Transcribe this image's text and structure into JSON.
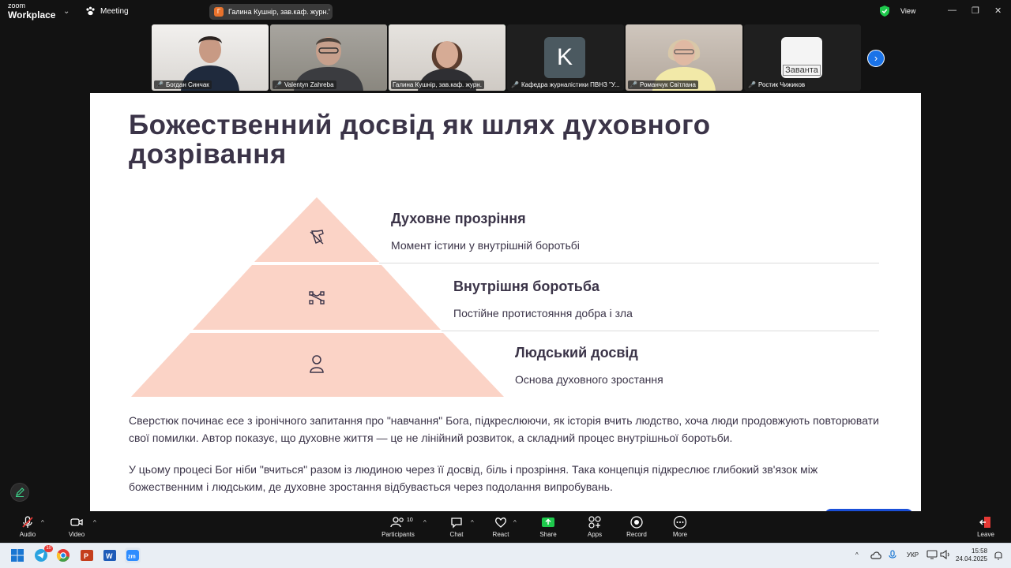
{
  "app": {
    "logo_line1": "zoom",
    "logo_line2": "Workplace",
    "meeting_label": "Meeting",
    "view_label": "View"
  },
  "share": {
    "presenter": "Галина Кушнір, зав.каф. журн.'",
    "presenter_initial": "Г"
  },
  "participants": [
    {
      "name": "Богдан Синчак",
      "type": "video"
    },
    {
      "name": "Valentyn Zahreba",
      "type": "video"
    },
    {
      "name": "Галина Кушнір, зав.каф. журн.",
      "type": "video"
    },
    {
      "name": "Кафедра журналістики ПВНЗ \"У...",
      "type": "avatar",
      "avatar_letter": "K"
    },
    {
      "name": "Романчук Світлана",
      "type": "video"
    },
    {
      "name": "Ростик Чижиков",
      "type": "image",
      "avatar_text": "Заванта"
    }
  ],
  "slide": {
    "title": "Божественний досвід як шлях духовного дозрівання",
    "tiers": [
      {
        "heading": "Духовне прозріння",
        "desc": "Момент істини у внутрішній боротьбі",
        "icon": "hand-pointer-icon"
      },
      {
        "heading": "Внутрішня боротьба",
        "desc": "Постійне протистояння добра і зла",
        "icon": "vector-nodes-icon"
      },
      {
        "heading": "Людський досвід",
        "desc": "Основа духовного зростання",
        "icon": "person-icon"
      }
    ],
    "paragraph1": "Сверстюк починає есе з іронічного запитання про \"навчання\" Бога, підкреслюючи, як історія вчить людство, хоча люди продовжують повторювати свої помилки. Автор показує, що духовне життя — це не лінійний розвиток, а складний процес внутрішньої боротьби.",
    "paragraph2": "У цьому процесі Бог ніби \"вчиться\" разом із людиною через її досвід, біль і прозріння. Така концепція підкреслює глибокий зв'язок між божественним і людським, де духовне зростання відбувається через подолання випробувань.",
    "pyramid_color": "#fbd3c6",
    "text_color": "#3b3448"
  },
  "toolbar": {
    "audio": "Audio",
    "video": "Video",
    "participants": "Participants",
    "participants_count": "10",
    "chat": "Chat",
    "react": "React",
    "share": "Share",
    "apps": "Apps",
    "record": "Record",
    "more": "More",
    "leave": "Leave",
    "share_color": "#1ec94c"
  },
  "taskbar": {
    "lang": "УКР",
    "time": "15:58",
    "date": "24.04.2025",
    "telegram_badge": "10"
  }
}
